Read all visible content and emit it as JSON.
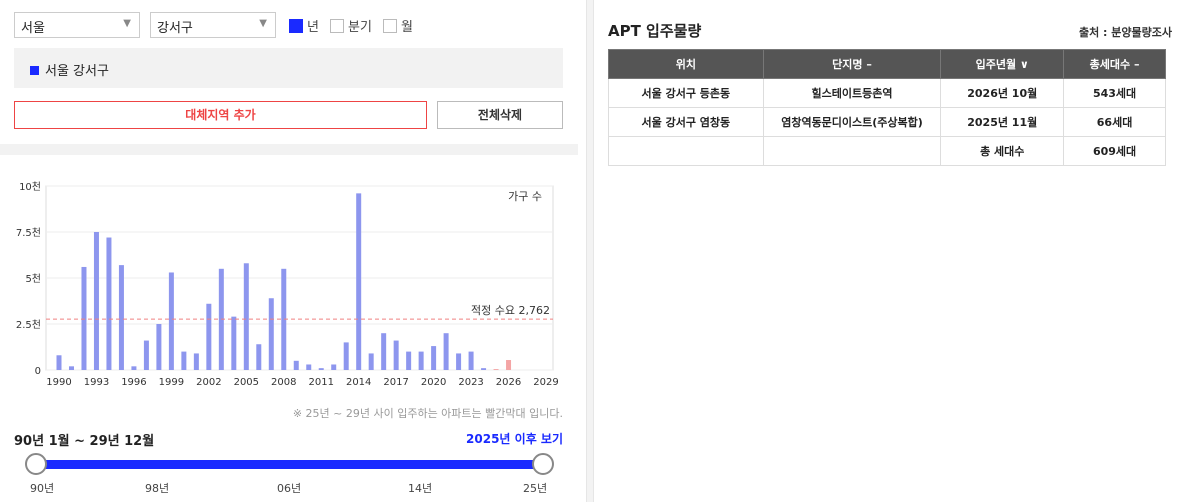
{
  "filters": {
    "city": "서울",
    "district": "강서구",
    "period_options": [
      {
        "label": "년",
        "checked": true
      },
      {
        "label": "분기",
        "checked": false
      },
      {
        "label": "월",
        "checked": false
      }
    ]
  },
  "selected_region": "서울 강서구",
  "buttons": {
    "add_alt": "대체지역 추가",
    "delete_all": "전체삭제"
  },
  "chart_data": {
    "type": "bar",
    "series_label": "가구 수",
    "y_ticks": [
      "0",
      "2.5천",
      "5천",
      "7.5천",
      "10천"
    ],
    "ylim": [
      0,
      10000
    ],
    "x_ticks": [
      "1990",
      "1993",
      "1996",
      "1999",
      "2002",
      "2005",
      "2008",
      "2011",
      "2014",
      "2017",
      "2020",
      "2023",
      "2026",
      "2029"
    ],
    "x": [
      1990,
      1991,
      1992,
      1993,
      1994,
      1995,
      1996,
      1997,
      1998,
      1999,
      2000,
      2001,
      2002,
      2003,
      2004,
      2005,
      2006,
      2007,
      2008,
      2009,
      2010,
      2011,
      2012,
      2013,
      2014,
      2015,
      2016,
      2017,
      2018,
      2019,
      2020,
      2021,
      2022,
      2023,
      2024,
      2025,
      2026
    ],
    "values": [
      800,
      200,
      5600,
      7500,
      7200,
      5700,
      200,
      1600,
      2500,
      5300,
      1000,
      900,
      3600,
      5500,
      2900,
      5800,
      1400,
      3900,
      5500,
      500,
      300,
      100,
      300,
      1500,
      9600,
      900,
      2000,
      1600,
      1000,
      1000,
      1300,
      2000,
      900,
      1000,
      100,
      50,
      543
    ],
    "highlight_color": "#f4a5a5",
    "bar_color": "#8d96ee",
    "highlight_from": 2025,
    "reference_line": {
      "value": 2762,
      "label": "적정 수요 2,762",
      "color": "#f08080"
    }
  },
  "note": "※ 25년 ~ 29년 사이 입주하는 아파트는 빨간막대 입니다.",
  "range": {
    "label": "90년 1월 ~ 29년 12월",
    "future_link": "2025년 이후 보기",
    "ticks": [
      "90년",
      "98년",
      "06년",
      "14년",
      "25년"
    ]
  },
  "right": {
    "title": "APT 입주물량",
    "source": "출처 : 분양물량조사",
    "headers": [
      "위치",
      "단지명 –",
      "입주년월 ∨",
      "총세대수 –"
    ],
    "rows": [
      [
        "서울 강서구 등촌동",
        "힐스테이트등촌역",
        "2026년 10월",
        "543세대"
      ],
      [
        "서울 강서구 염창동",
        "염창역동문디이스트(주상복합)",
        "2025년 11월",
        "66세대"
      ],
      [
        "",
        "",
        "총 세대수",
        "609세대"
      ]
    ]
  }
}
